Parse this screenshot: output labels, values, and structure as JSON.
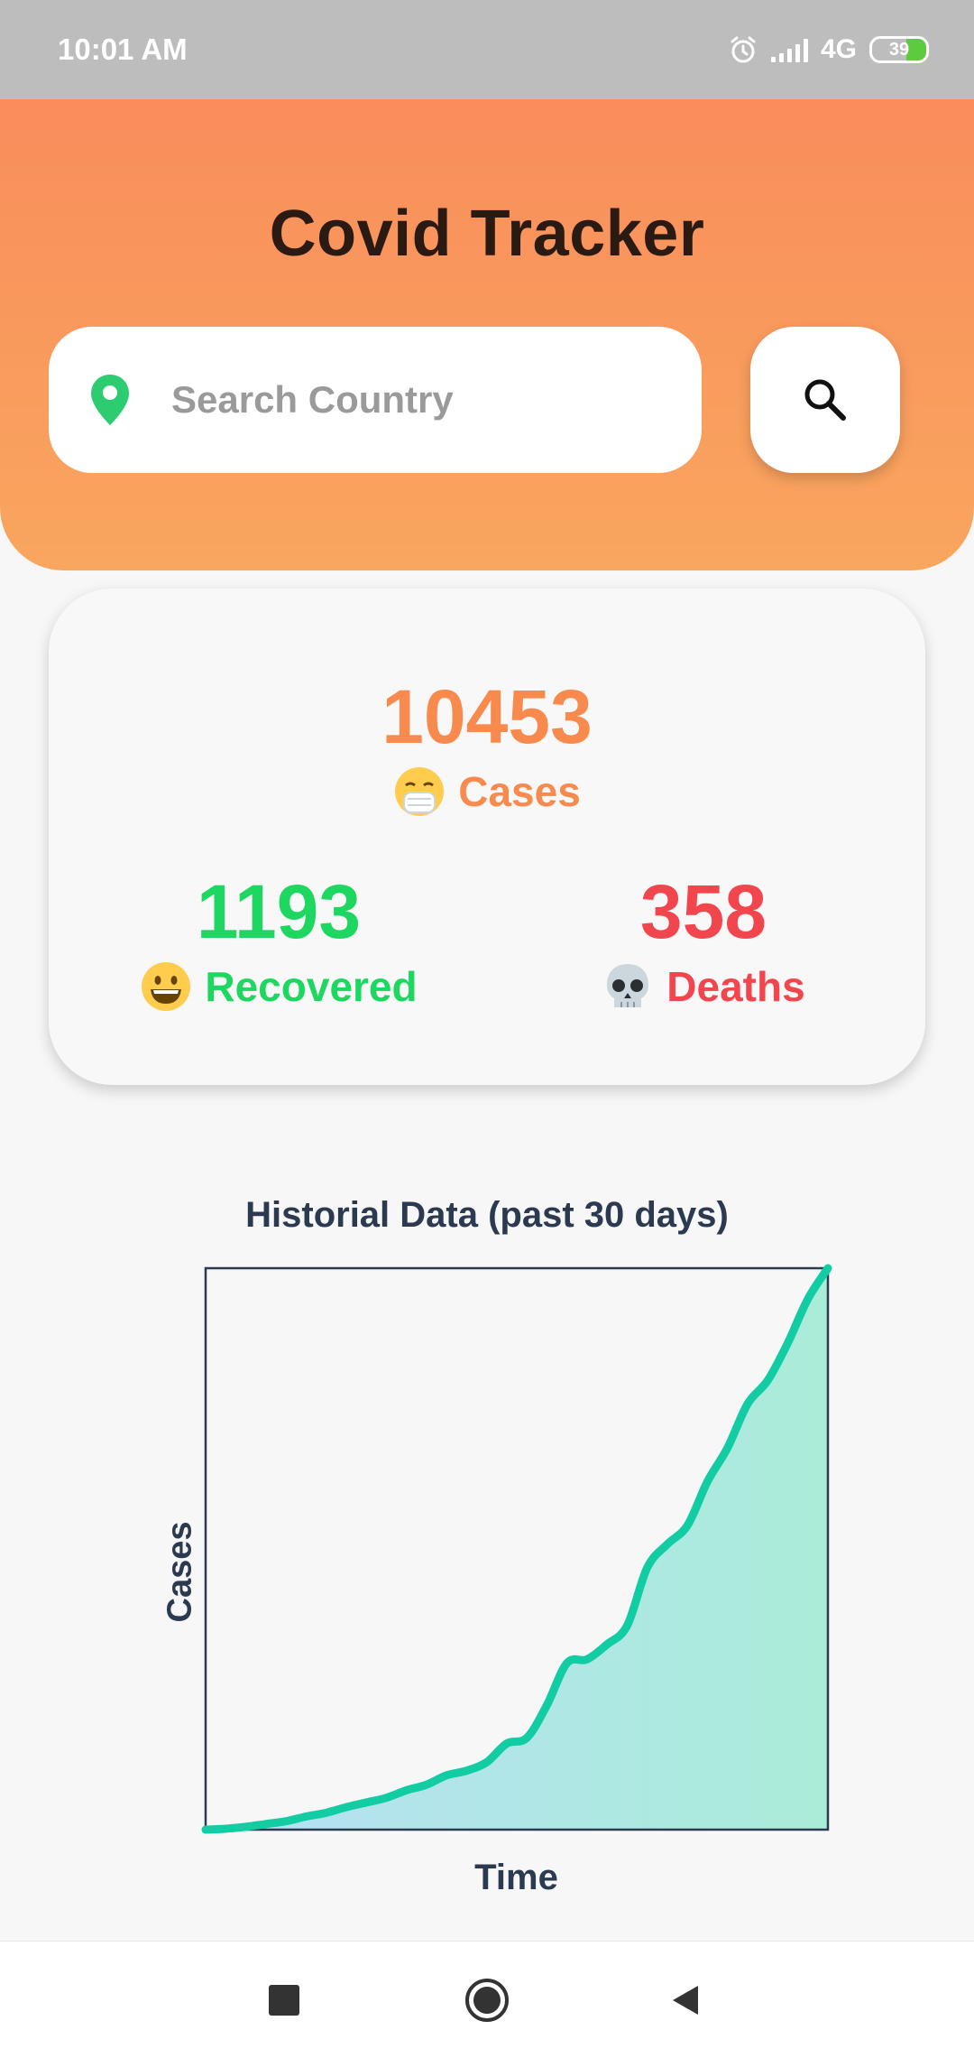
{
  "status_bar": {
    "time": "10:01 AM",
    "network": "4G",
    "battery": "39",
    "icons": [
      "alarm-icon",
      "signal-icon",
      "battery-icon"
    ]
  },
  "header": {
    "title": "Covid Tracker",
    "search": {
      "placeholder": "Search Country",
      "value": ""
    },
    "icons": [
      "location-pin-icon",
      "search-icon"
    ]
  },
  "stats": {
    "cases": {
      "value": "10453",
      "label": "Cases",
      "icon": "mask-face-emoji",
      "color": "#f88a4d"
    },
    "recovered": {
      "value": "1193",
      "label": "Recovered",
      "icon": "grinning-face-emoji",
      "color": "#1ed760"
    },
    "deaths": {
      "value": "358",
      "label": "Deaths",
      "icon": "skull-emoji",
      "color": "#f2464e"
    }
  },
  "chart_data": {
    "type": "area",
    "title": "Historial Data (past 30 days)",
    "xlabel": "Time",
    "ylabel": "Cases",
    "grid": false,
    "legend": "none",
    "series": [
      {
        "values": [
          0,
          1,
          3,
          6,
          9,
          14,
          18,
          24,
          29,
          34,
          42,
          48,
          58,
          63,
          72,
          92,
          98,
          133,
          178,
          182,
          198,
          218,
          280,
          305,
          325,
          372,
          408,
          455,
          480,
          520,
          567,
          600
        ]
      }
    ],
    "ylim": [
      0,
      600
    ],
    "colors": {
      "line": "#12cca3",
      "fill_start": "#b7e0f5",
      "fill_end": "#a9ecd8",
      "axis": "#2b3a50"
    }
  },
  "nav": {
    "icons": [
      "recent-apps-icon",
      "home-icon",
      "back-icon"
    ]
  }
}
